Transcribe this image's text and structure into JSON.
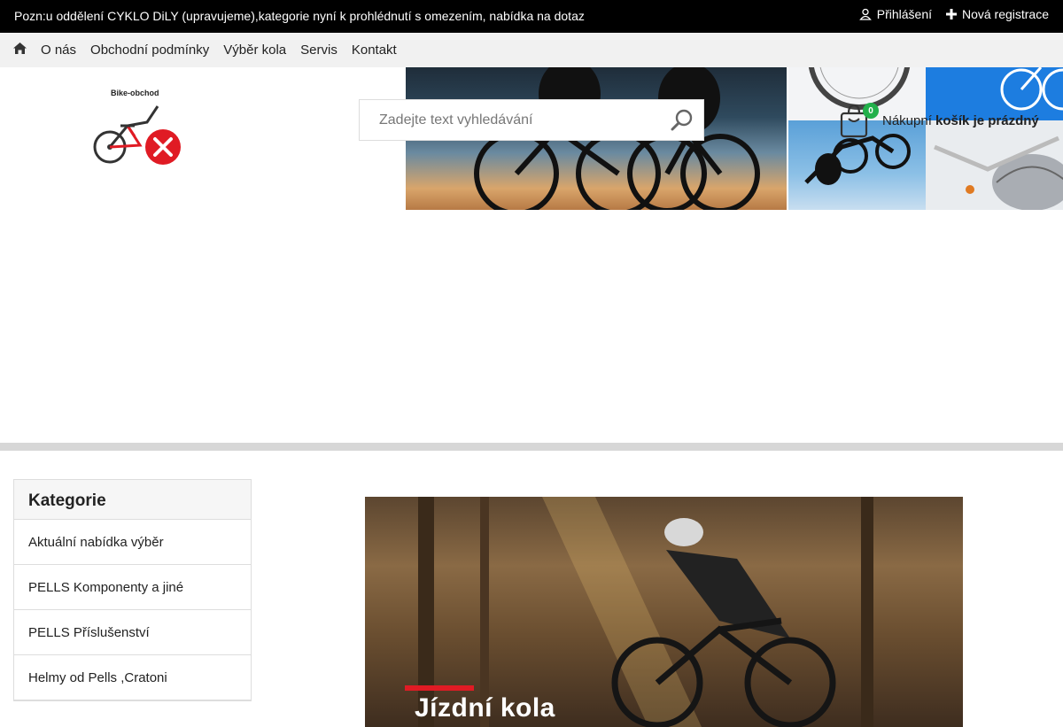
{
  "topbar": {
    "notice": "Pozn:u oddělení CYKLO DiLY (upravujeme),kategorie nyní k prohlédnutí s omezením, nabídka na dotaz",
    "login_label": "Přihlášení",
    "register_label": "Nová registrace"
  },
  "nav": {
    "items": [
      {
        "label": "O nás"
      },
      {
        "label": "Obchodní podmínky"
      },
      {
        "label": "Výběr kola"
      },
      {
        "label": "Servis"
      },
      {
        "label": "Kontakt"
      }
    ]
  },
  "logo": {
    "text": "Bike-obchod"
  },
  "search": {
    "placeholder": "Zadejte text vyhledávání"
  },
  "cart": {
    "count": "0",
    "label": "Nákupní",
    "status": "košík je prázdný"
  },
  "sidebar": {
    "title": "Kategorie",
    "items": [
      {
        "label": "Aktuální nabídka výběr"
      },
      {
        "label": "PELLS Komponenty a jiné"
      },
      {
        "label": "PELLS Příslušenství"
      },
      {
        "label": "Helmy od Pells ,Cratoni"
      }
    ]
  },
  "hero": {
    "title": "Jízdní kola"
  },
  "colors": {
    "accent": "#e01b24",
    "badge": "#22b04b",
    "topbar": "#000000"
  }
}
